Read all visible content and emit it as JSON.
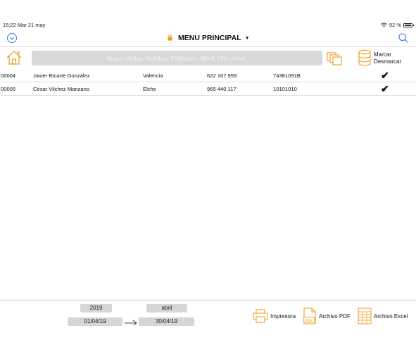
{
  "status_bar": {
    "time_date": "15:22  Mar 21 may",
    "battery": "92 %"
  },
  "nav": {
    "title": "MENU PRINCIPAL",
    "caret": "▾",
    "left_icon": "chevron-down-circle-icon",
    "right_icon": "search-icon"
  },
  "toolbar": {
    "search_placeholder": "Busco código, Nombre, Población, Móvil, DNI, email.",
    "mark": "Marcar",
    "unmark": "Desmarcar"
  },
  "records": [
    {
      "code": "00004",
      "name": "Javier Ricarte González",
      "city": "Valencia",
      "phone": "622 167 959",
      "dni": "74381091B",
      "checked": "✔"
    },
    {
      "code": "00005",
      "name": "César Vilchez Manzano",
      "city": "Elche",
      "phone": "965 440 117",
      "dni": "10101010",
      "checked": "✔"
    }
  ],
  "footer": {
    "year": "2019",
    "month": "abril",
    "date_from": "01/04/19",
    "date_to": "30/04/19",
    "print_label": "Impresora",
    "pdf_label": "Archivo PDF",
    "excel_label": "Archivo Excel"
  },
  "colors": {
    "accent_orange": "#f29a1a",
    "accent_blue": "#2f7cf6"
  }
}
